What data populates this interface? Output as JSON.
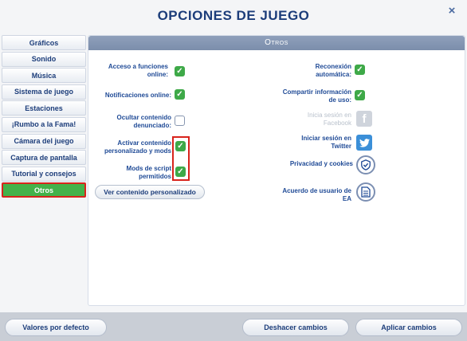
{
  "dialog": {
    "title": "Opciones de juego",
    "close_glyph": "×"
  },
  "nav": {
    "items": [
      {
        "label": "Gráficos"
      },
      {
        "label": "Sonido"
      },
      {
        "label": "Música"
      },
      {
        "label": "Sistema de juego"
      },
      {
        "label": "Estaciones"
      },
      {
        "label": "¡Rumbo a la Fama!"
      },
      {
        "label": "Cámara del juego"
      },
      {
        "label": "Captura de pantalla"
      },
      {
        "label": "Tutorial y consejos"
      },
      {
        "label": "Otros",
        "active": true
      }
    ]
  },
  "panel": {
    "header": "Otros",
    "left_options": [
      {
        "label_line1": "Acceso a funciones",
        "label_line2": "online:",
        "checked": true
      },
      {
        "label_line1": "Notificaciones online:",
        "label_line2": "",
        "checked": true
      },
      {
        "label_line1": "Ocultar contenido",
        "label_line2": "denunciado:",
        "checked": false
      },
      {
        "label_line1": "Activar contenido",
        "label_line2": "personalizado y mods",
        "checked": true
      },
      {
        "label_line1": "Mods de script",
        "label_line2": "permitidos",
        "checked": true
      }
    ],
    "view_custom_button": "Ver contenido personalizado",
    "right_options": {
      "reconnect": {
        "line1": "Reconexión",
        "line2": "automática:",
        "checked": true
      },
      "share_info": {
        "line1": "Compartir información",
        "line2": "de uso:",
        "checked": true
      },
      "facebook": {
        "line1": "Inicia sesión en",
        "line2": "Facebook",
        "icon": "facebook-icon",
        "glyph": "f"
      },
      "twitter": {
        "line1": "Iniciar sesión en",
        "line2": "Twitter",
        "icon": "twitter-icon",
        "glyph": "🐦"
      },
      "privacy": {
        "label": "Privacidad y cookies",
        "icon": "shield-check-icon"
      },
      "eula": {
        "line1": "Acuerdo de usuario de",
        "line2": "EA",
        "icon": "document-icon"
      }
    }
  },
  "footer": {
    "defaults": "Valores por defecto",
    "undo": "Deshacer cambios",
    "apply": "Aplicar cambios"
  },
  "colors": {
    "accent_green": "#43b24a",
    "highlight_red": "#d8231c",
    "text_blue": "#1c3d7a"
  }
}
